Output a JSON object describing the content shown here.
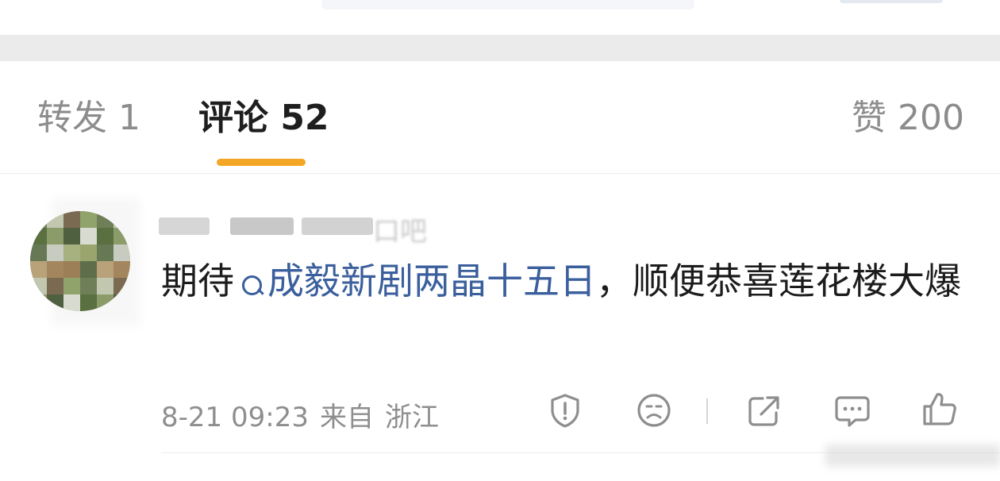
{
  "tabs": {
    "repost": "转发 1",
    "comments": "评论 52",
    "likes": "赞 200",
    "active": "comments",
    "accent_color": "#f3a724"
  },
  "comment": {
    "text_before": "期待",
    "topic": "成毅新剧两晶十五日",
    "text_after": "，顺便恭喜莲花楼大爆",
    "date": "8-21 09:23",
    "source_label": "来自",
    "location": "浙江",
    "topic_color": "#3a5f9c"
  },
  "icons": {
    "topic": "search-icon",
    "report": "shield-alert-icon",
    "dislike": "sad-face-icon",
    "share": "share-icon",
    "reply": "comment-icon",
    "like": "thumbs-up-icon"
  }
}
